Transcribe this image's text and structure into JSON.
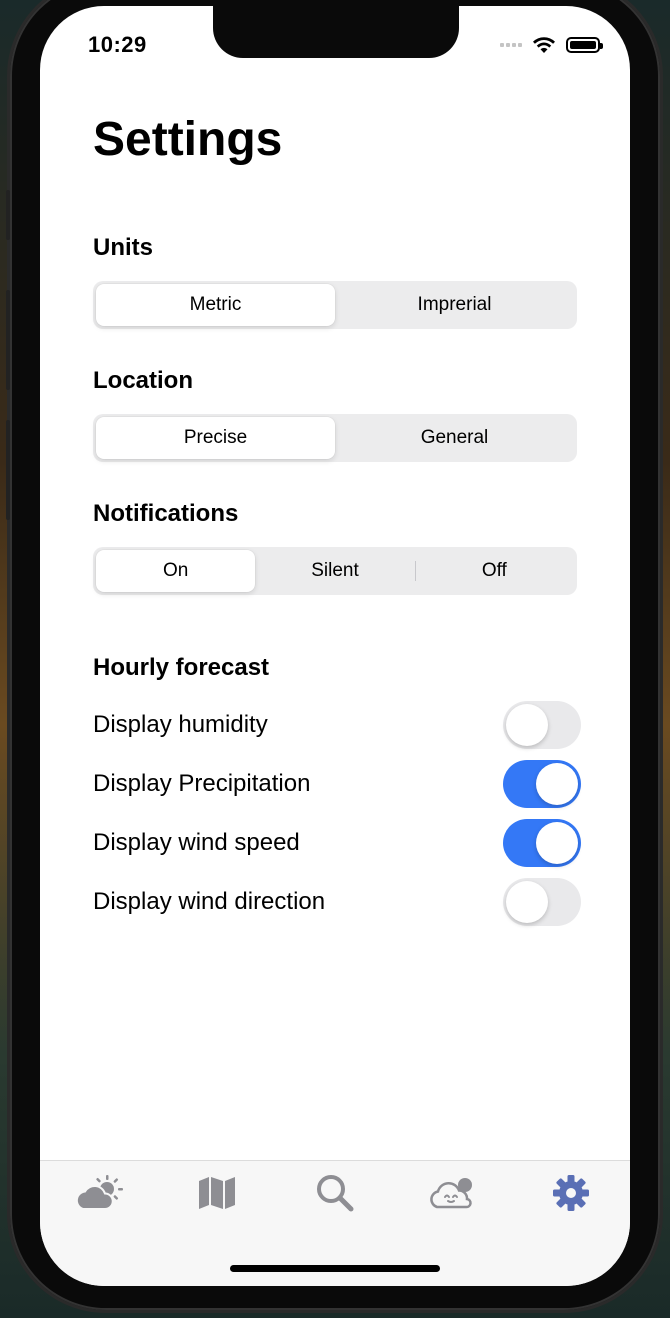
{
  "status_bar": {
    "time": "10:29"
  },
  "page": {
    "title": "Settings"
  },
  "units": {
    "label": "Units",
    "options": [
      "Metric",
      "Imprerial"
    ],
    "selected": "Metric"
  },
  "location": {
    "label": "Location",
    "options": [
      "Precise",
      "General"
    ],
    "selected": "Precise"
  },
  "notifications": {
    "label": "Notifications",
    "options": [
      "On",
      "Silent",
      "Off"
    ],
    "selected": "On"
  },
  "hourly_forecast": {
    "label": "Hourly forecast",
    "toggles": [
      {
        "label": "Display humidity",
        "on": false
      },
      {
        "label": "Display Precipitation",
        "on": true
      },
      {
        "label": "Display wind speed",
        "on": true
      },
      {
        "label": "Display wind direction",
        "on": false
      }
    ]
  },
  "tab_bar": {
    "items": [
      {
        "icon": "partly-sunny-icon",
        "active": false
      },
      {
        "icon": "map-icon",
        "active": false
      },
      {
        "icon": "search-icon",
        "active": false
      },
      {
        "icon": "cloud-face-icon",
        "active": false
      },
      {
        "icon": "gear-icon",
        "active": true
      }
    ]
  },
  "colors": {
    "accent": "#3478f6",
    "tab_active": "#5a6fb5",
    "tab_inactive": "#8e8e93"
  }
}
